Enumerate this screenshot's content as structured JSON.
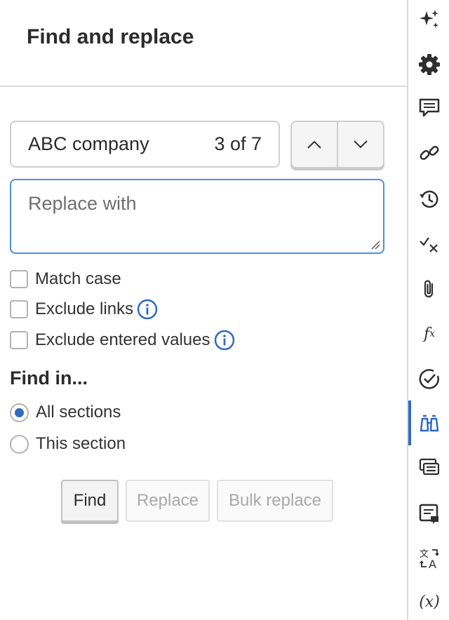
{
  "panel": {
    "title": "Find and replace"
  },
  "find": {
    "value": "ABC company",
    "count": "3 of 7",
    "prev_icon": "chevron-up-icon",
    "next_icon": "chevron-down-icon"
  },
  "replace": {
    "placeholder": "Replace with"
  },
  "options": {
    "match_case": {
      "label": "Match case",
      "checked": false
    },
    "exclude_links": {
      "label": "Exclude links",
      "checked": false
    },
    "exclude_entered": {
      "label": "Exclude entered values",
      "checked": false
    }
  },
  "scope": {
    "heading": "Find in...",
    "all_sections": {
      "label": "All sections",
      "selected": true
    },
    "this_section": {
      "label": "This section",
      "selected": false
    }
  },
  "buttons": {
    "find": "Find",
    "replace": "Replace",
    "bulk_replace": "Bulk replace"
  },
  "rail": {
    "items": [
      {
        "icon": "sparkle-icon"
      },
      {
        "icon": "gear-icon"
      },
      {
        "icon": "comment-icon"
      },
      {
        "icon": "link-icon"
      },
      {
        "icon": "history-icon"
      },
      {
        "icon": "checkmark-x-icon"
      },
      {
        "icon": "paperclip-icon"
      },
      {
        "icon": "function-icon"
      },
      {
        "icon": "check-circle-icon"
      },
      {
        "icon": "binoculars-icon",
        "active": true
      },
      {
        "icon": "cards-icon"
      },
      {
        "icon": "note-icon"
      },
      {
        "icon": "translate-icon"
      },
      {
        "icon": "variable-icon"
      }
    ],
    "accent": "#2f6bc4"
  },
  "colors": {
    "accent": "#2f6bc4",
    "focus_border": "#4a90e2",
    "info": "#2f6bc4"
  }
}
